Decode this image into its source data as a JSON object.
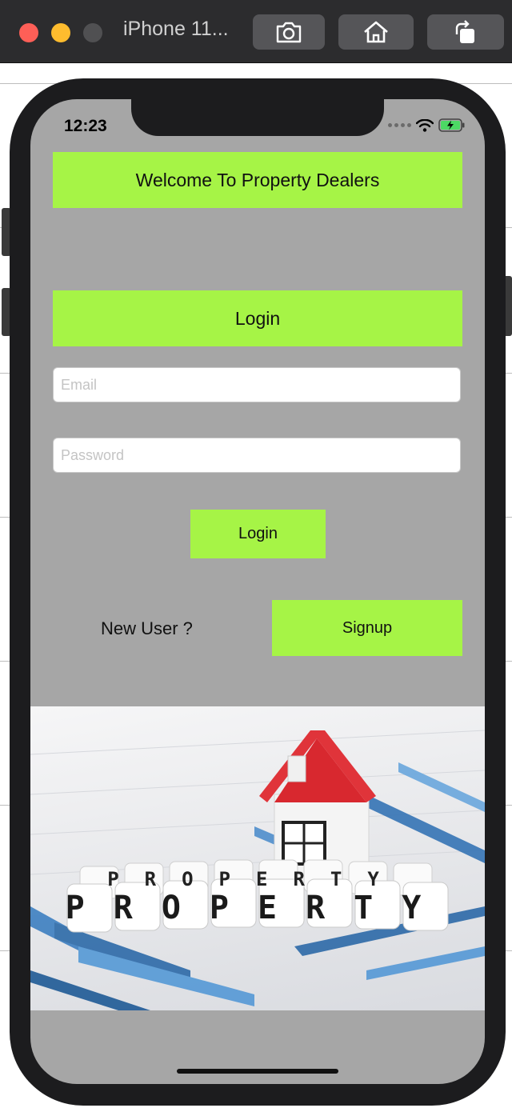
{
  "window": {
    "title": "iPhone 11..."
  },
  "toolbar": {
    "screenshot_icon": "camera-icon",
    "home_icon": "home-icon",
    "rotate_icon": "rotate-icon"
  },
  "status_bar": {
    "time": "12:23"
  },
  "app": {
    "welcome_text": "Welcome To Property Dealers",
    "login_header": "Login",
    "email_placeholder": "Email",
    "password_placeholder": "Password",
    "login_button": "Login",
    "new_user_label": "New User ?",
    "signup_button": "Signup",
    "banner_image_text": "PROPERTY"
  },
  "colors": {
    "accent_green": "#a6f446",
    "screen_bg": "#a6a6a6",
    "device_frame": "#1c1c1e"
  }
}
